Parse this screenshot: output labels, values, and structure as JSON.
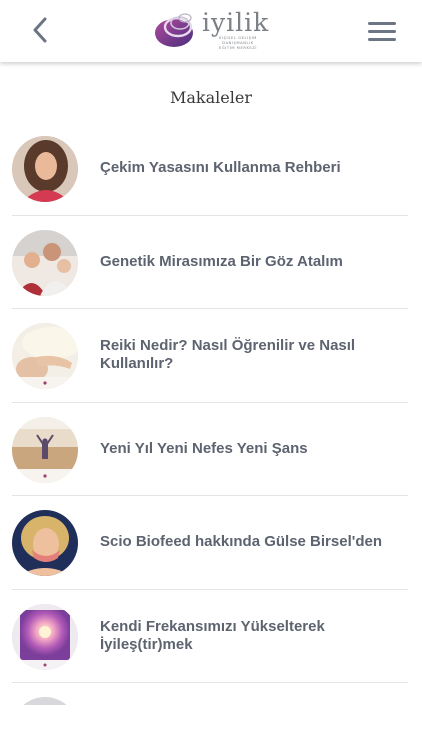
{
  "header": {
    "logo_text": "iyilik",
    "logo_sub": [
      "KİŞİSEL GELİŞİM",
      "DANIŞMANLIK",
      "EĞİTİM MERKEZİ"
    ],
    "back_icon": "chevron-left-icon",
    "menu_icon": "hamburger-menu-icon"
  },
  "page": {
    "title": "Makaleler"
  },
  "articles": [
    {
      "title": "Çekim Yasasını Kullanma Rehberi",
      "thumb": "woman-portrait"
    },
    {
      "title": "Genetik Mirasımıza Bir Göz Atalım",
      "thumb": "family-photo"
    },
    {
      "title": "Reiki Nedir? Nasıl Öğrenilir ve Nasıl Kullanılır?",
      "thumb": "reiki-hands"
    },
    {
      "title": "Yeni Yıl Yeni Nefes Yeni Şans",
      "thumb": "field-sunset"
    },
    {
      "title": "Scio Biofeed hakkında Gülse Birsel'den",
      "thumb": "blonde-woman-portrait"
    },
    {
      "title": "Kendi Frekansımızı Yükselterek İyileş(tir)mek",
      "thumb": "aura-figure"
    }
  ],
  "colors": {
    "title_text": "#5d6470",
    "icon_gray": "#6b7583",
    "divider": "#e4e4e4"
  }
}
